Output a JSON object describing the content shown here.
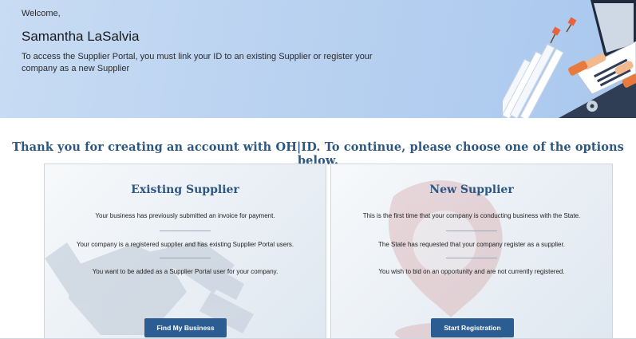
{
  "banner": {
    "greeting": "Welcome,",
    "user_name": "Samantha LaSalvia",
    "intro": "To access the Supplier Portal, you must link your ID to an existing Supplier or register your company as a new Supplier"
  },
  "headline": "Thank you for creating an account with OH|ID. To continue, please choose one of the options below.",
  "existing_supplier": {
    "title": "Existing Supplier",
    "lines": [
      "Your business has previously submitted an invoice for payment.",
      "Your company is a registered supplier and has existing Supplier Portal users.",
      "You want to be added as a Supplier Portal user for your company."
    ],
    "button_label": "Find My Business"
  },
  "new_supplier": {
    "title": "New Supplier",
    "lines": [
      "This is the first time that your company is conducting business with the State.",
      "The State has requested that your company register as a supplier.",
      "You wish to bid on an opportunity and are not currently registered."
    ],
    "button_label": "Start Registration"
  },
  "colors": {
    "accent": "#2d5780",
    "button": "#2c5d92",
    "banner": "#b5cff0"
  }
}
